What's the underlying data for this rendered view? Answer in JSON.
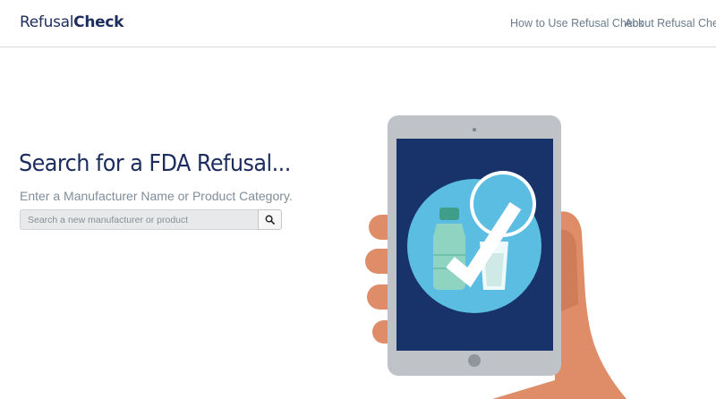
{
  "header": {
    "brand_regular": "Refusal",
    "brand_bold": "Check",
    "nav": [
      {
        "label": "How to Use Refusal Check"
      },
      {
        "label": "About Refusal Check"
      }
    ]
  },
  "hero": {
    "title": "Search for a FDA Refusal...",
    "subtitle": "Enter a Manufacturer Name or Product Category.",
    "search": {
      "placeholder": "Search a new manufacturer or product",
      "value": "",
      "button_icon": "search-icon"
    }
  },
  "illustration": {
    "icons": [
      "tablet-icon",
      "hand-icon",
      "water-bottle-icon",
      "glass-icon",
      "checkmark-icon"
    ]
  },
  "colors": {
    "brand": "#1c2d5e",
    "nav_text": "#6b7c8c",
    "subtitle": "#7f8d9a",
    "screen": "#17336a",
    "circle": "#5bbde2",
    "tablet": "#bfc3c8",
    "skin": "#de8d68"
  }
}
